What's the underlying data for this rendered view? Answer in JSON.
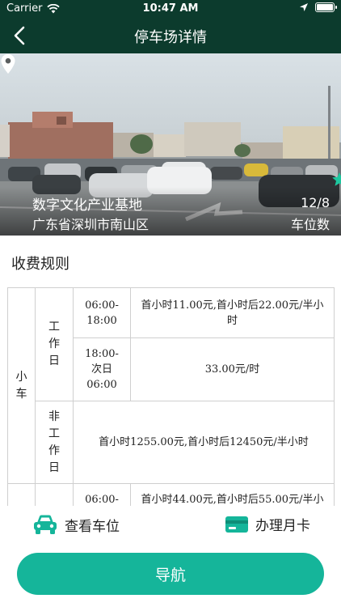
{
  "status_bar": {
    "carrier": "Carrier",
    "time": "10:47 AM"
  },
  "nav": {
    "title": "停车场详情"
  },
  "lot": {
    "name": "数字文化产业基地",
    "address": "广东省深圳市南山区",
    "rating": 4,
    "rating_max": 4,
    "spaces": "12/8",
    "spaces_label": "车位数"
  },
  "fee_rules": {
    "title": "收费规则",
    "vehicle_car": "小车",
    "workday": "工作日",
    "nonworkday": "非工作日",
    "rows": [
      {
        "time": "06:00-18:00",
        "price": "首小时11.00元,首小时后22.00元/半小时"
      },
      {
        "time": "18:00-次日06:00",
        "price": "33.00元/时"
      }
    ],
    "nonworkday_price": "首小时1255.00元,首小时后12450元/半小时",
    "next_row": {
      "time": "06:00-",
      "price": "首小时44.00元,首小时后55.00元/半小"
    }
  },
  "actions": {
    "view_spaces": "查看车位",
    "monthly_card": "办理月卡",
    "navigate": "导航"
  },
  "colors": {
    "header": "#0c3b2d",
    "accent": "#15b59a",
    "star": "#1ec8a0"
  },
  "icons": [
    "wifi-icon",
    "location-arrow-icon",
    "battery-icon",
    "back-chevron-icon",
    "map-pin-icon",
    "star-icon",
    "car-icon",
    "card-icon"
  ]
}
